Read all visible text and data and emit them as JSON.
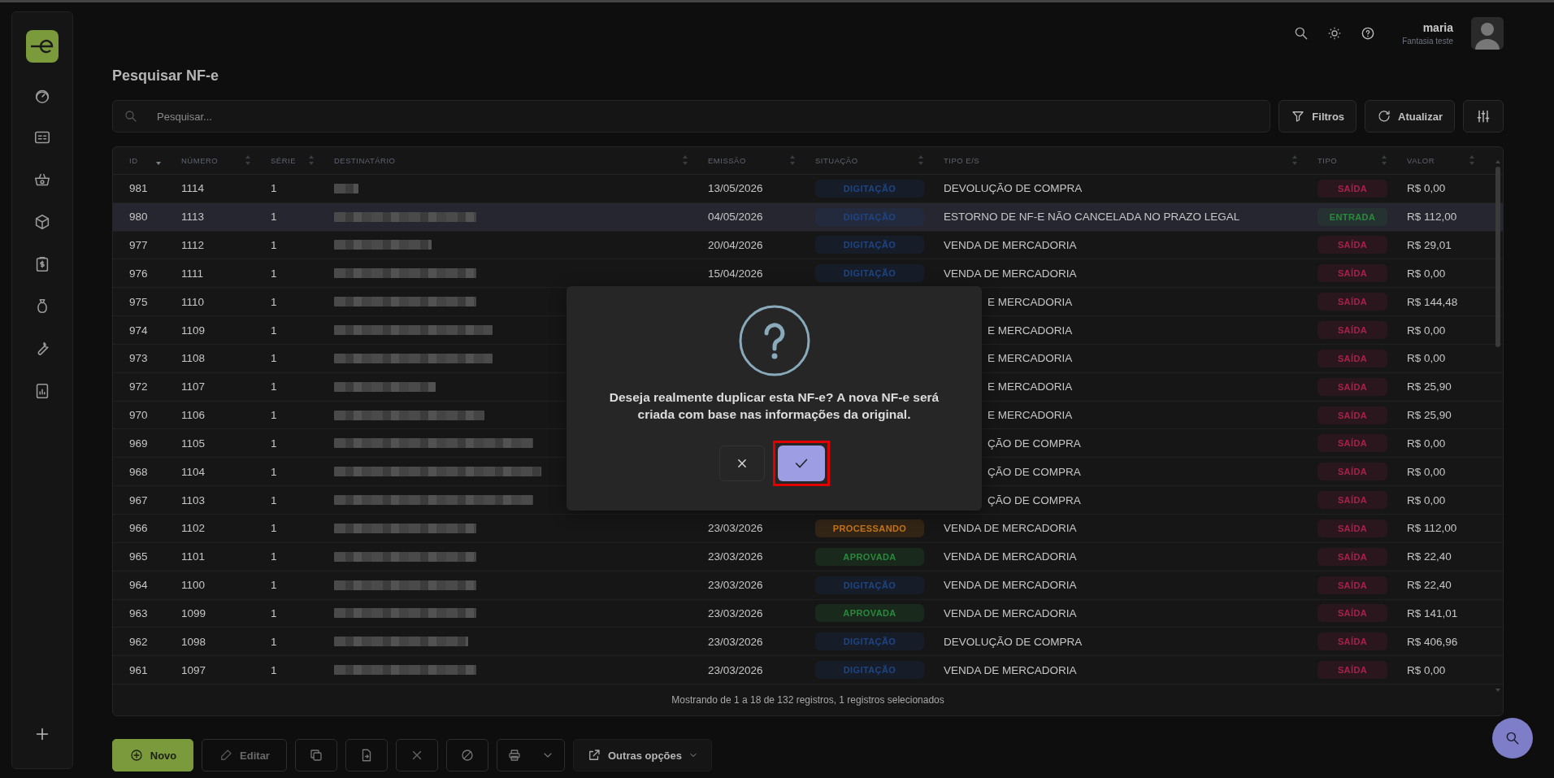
{
  "page_title": "Pesquisar NF-e",
  "user": {
    "name": "maria",
    "company": "Fantasia teste"
  },
  "search": {
    "placeholder": "Pesquisar..."
  },
  "actions": {
    "filters": "Filtros",
    "refresh": "Atualizar"
  },
  "table": {
    "columns": [
      {
        "label": "ID",
        "sorted": true
      },
      {
        "label": "NÚMERO",
        "sorted": false
      },
      {
        "label": "SÉRIE",
        "sorted": false
      },
      {
        "label": "DESTINATÁRIO",
        "sorted": false
      },
      {
        "label": "EMISSÃO",
        "sorted": false
      },
      {
        "label": "SITUAÇÃO",
        "sorted": false
      },
      {
        "label": "TIPO E/S",
        "sorted": false
      },
      {
        "label": "TIPO",
        "sorted": false
      },
      {
        "label": "VALOR",
        "sorted": false
      }
    ],
    "rows": [
      {
        "id": "981",
        "numero": "1114",
        "serie": "1",
        "emissao": "13/05/2026",
        "situacao": {
          "label": "DIGITAÇÃO",
          "color": "#1d4585"
        },
        "tipo_es": "DEVOLUÇÃO DE COMPRA",
        "tipo": {
          "label": "SAÍDA",
          "color": "#a8214c"
        },
        "valor": "R$ 0,00",
        "selected": false
      },
      {
        "id": "980",
        "numero": "1113",
        "serie": "1",
        "emissao": "04/05/2026",
        "situacao": {
          "label": "DIGITAÇÃO",
          "color": "#1d4585"
        },
        "tipo_es": "ESTORNO DE NF-E NÃO CANCELADA NO PRAZO LEGAL",
        "tipo": {
          "label": "ENTRADA",
          "color": "#2a8a3c"
        },
        "valor": "R$ 112,00",
        "selected": true
      },
      {
        "id": "977",
        "numero": "1112",
        "serie": "1",
        "emissao": "20/04/2026",
        "situacao": {
          "label": "DIGITAÇÃO",
          "color": "#1d4585"
        },
        "tipo_es": "VENDA DE MERCADORIA",
        "tipo": {
          "label": "SAÍDA",
          "color": "#a8214c"
        },
        "valor": "R$ 29,01",
        "selected": false
      },
      {
        "id": "976",
        "numero": "1111",
        "serie": "1",
        "emissao": "15/04/2026",
        "situacao": {
          "label": "DIGITAÇÃO",
          "color": "#1d4585"
        },
        "tipo_es": "VENDA DE MERCADORIA",
        "tipo": {
          "label": "SAÍDA",
          "color": "#a8214c"
        },
        "valor": "R$ 0,00",
        "selected": false
      },
      {
        "id": "975",
        "numero": "1110",
        "serie": "1",
        "tipo_es": "E MERCADORIA",
        "tipo": {
          "label": "SAÍDA",
          "color": "#a8214c"
        },
        "valor": "R$ 144,48",
        "selected": false
      },
      {
        "id": "974",
        "numero": "1109",
        "serie": "1",
        "tipo_es": "E MERCADORIA",
        "tipo": {
          "label": "SAÍDA",
          "color": "#a8214c"
        },
        "valor": "R$ 0,00",
        "selected": false
      },
      {
        "id": "973",
        "numero": "1108",
        "serie": "1",
        "tipo_es": "E MERCADORIA",
        "tipo": {
          "label": "SAÍDA",
          "color": "#a8214c"
        },
        "valor": "R$ 0,00",
        "selected": false
      },
      {
        "id": "972",
        "numero": "1107",
        "serie": "1",
        "tipo_es": "E MERCADORIA",
        "tipo": {
          "label": "SAÍDA",
          "color": "#a8214c"
        },
        "valor": "R$ 25,90",
        "selected": false
      },
      {
        "id": "970",
        "numero": "1106",
        "serie": "1",
        "tipo_es": "E MERCADORIA",
        "tipo": {
          "label": "SAÍDA",
          "color": "#a8214c"
        },
        "valor": "R$ 25,90",
        "selected": false
      },
      {
        "id": "969",
        "numero": "1105",
        "serie": "1",
        "tipo_es": "ÇÃO DE COMPRA",
        "tipo": {
          "label": "SAÍDA",
          "color": "#a8214c"
        },
        "valor": "R$ 0,00",
        "selected": false
      },
      {
        "id": "968",
        "numero": "1104",
        "serie": "1",
        "tipo_es": "ÇÃO DE COMPRA",
        "tipo": {
          "label": "SAÍDA",
          "color": "#a8214c"
        },
        "valor": "R$ 0,00",
        "selected": false
      },
      {
        "id": "967",
        "numero": "1103",
        "serie": "1",
        "tipo_es": "ÇÃO DE COMPRA",
        "tipo": {
          "label": "SAÍDA",
          "color": "#a8214c"
        },
        "valor": "R$ 0,00",
        "selected": false
      },
      {
        "id": "966",
        "numero": "1102",
        "serie": "1",
        "emissao": "23/03/2026",
        "situacao": {
          "label": "PROCESSANDO",
          "color": "#c47416"
        },
        "tipo_es": "VENDA DE MERCADORIA",
        "tipo": {
          "label": "SAÍDA",
          "color": "#a8214c"
        },
        "valor": "R$ 112,00",
        "selected": false
      },
      {
        "id": "965",
        "numero": "1101",
        "serie": "1",
        "emissao": "23/03/2026",
        "situacao": {
          "label": "APROVADA",
          "color": "#2a8a3c"
        },
        "tipo_es": "VENDA DE MERCADORIA",
        "tipo": {
          "label": "SAÍDA",
          "color": "#a8214c"
        },
        "valor": "R$ 22,40",
        "selected": false
      },
      {
        "id": "964",
        "numero": "1100",
        "serie": "1",
        "emissao": "23/03/2026",
        "situacao": {
          "label": "DIGITAÇÃO",
          "color": "#1d4585"
        },
        "tipo_es": "VENDA DE MERCADORIA",
        "tipo": {
          "label": "SAÍDA",
          "color": "#a8214c"
        },
        "valor": "R$ 22,40",
        "selected": false
      },
      {
        "id": "963",
        "numero": "1099",
        "serie": "1",
        "emissao": "23/03/2026",
        "situacao": {
          "label": "APROVADA",
          "color": "#2a8a3c"
        },
        "tipo_es": "VENDA DE MERCADORIA",
        "tipo": {
          "label": "SAÍDA",
          "color": "#a8214c"
        },
        "valor": "R$ 141,01",
        "selected": false
      },
      {
        "id": "962",
        "numero": "1098",
        "serie": "1",
        "emissao": "23/03/2026",
        "situacao": {
          "label": "DIGITAÇÃO",
          "color": "#1d4585"
        },
        "tipo_es": "DEVOLUÇÃO DE COMPRA",
        "tipo": {
          "label": "SAÍDA",
          "color": "#a8214c"
        },
        "valor": "R$ 406,96",
        "selected": false
      },
      {
        "id": "961",
        "numero": "1097",
        "serie": "1",
        "emissao": "23/03/2026",
        "situacao": {
          "label": "DIGITAÇÃO",
          "color": "#1d4585"
        },
        "tipo_es": "VENDA DE MERCADORIA",
        "tipo": {
          "label": "SAÍDA",
          "color": "#a8214c"
        },
        "valor": "R$ 0,00",
        "selected": false
      }
    ],
    "footer": "Mostrando de 1 a 18 de 132 registros, 1 registros selecionados"
  },
  "toolbar": {
    "new": "Novo",
    "edit": {
      "label": "Editar",
      "disabled": true
    },
    "more": "Outras opções"
  },
  "dialog": {
    "message": "Deseja realmente duplicar esta NF-e? A nova NF-e será criada com base nas informações da original."
  }
}
